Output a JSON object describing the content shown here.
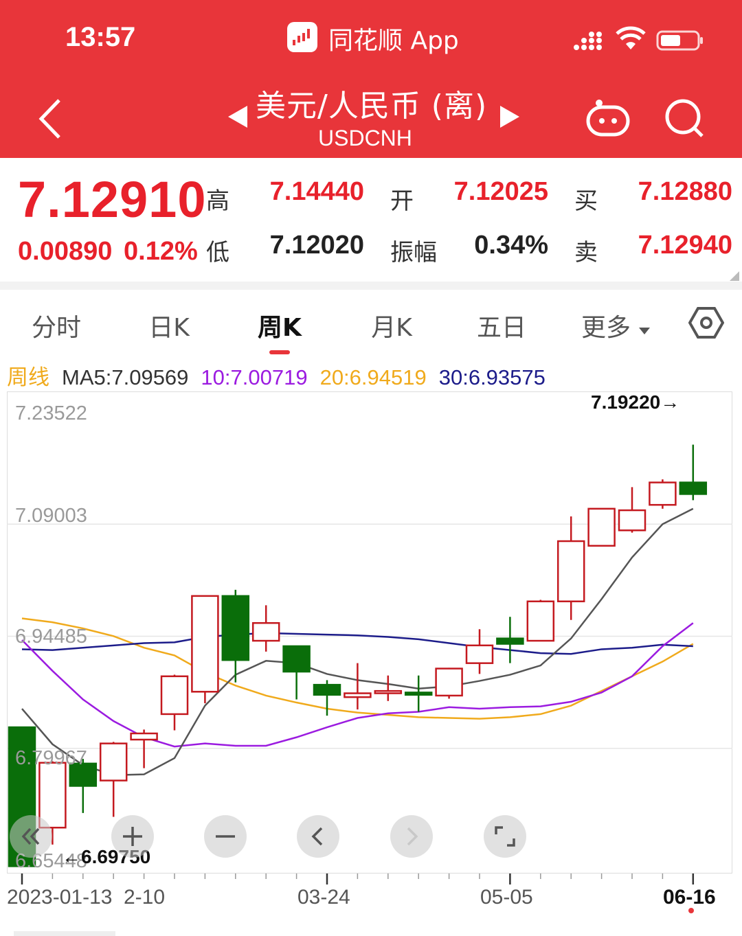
{
  "status_bar": {
    "time": "13:57",
    "app_name": "同花顺 App"
  },
  "header": {
    "title": "美元/人民币 (离)",
    "subtitle": "USDCNH"
  },
  "quote": {
    "last": "7.12910",
    "change": "0.00890",
    "change_pct": "0.12%",
    "high_label": "高",
    "high": "7.14440",
    "low_label": "低",
    "low": "7.12020",
    "open_label": "开",
    "open": "7.12025",
    "amp_label": "振幅",
    "amp": "0.34%",
    "bid_label": "买",
    "bid": "7.12880",
    "ask_label": "卖",
    "ask": "7.12940"
  },
  "tabs": [
    "分时",
    "日K",
    "周K",
    "月K",
    "五日",
    "更多"
  ],
  "active_tab": "周K",
  "ma_legend": {
    "label": "周线",
    "ma5": "MA5:7.09569",
    "ma10": "10:7.00719",
    "ma20": "20:6.94519",
    "ma30": "30:6.93575"
  },
  "colors": {
    "brand": "#e8353a",
    "up": "#c4191f",
    "down": "#0a6e0a",
    "ma5": "#555555",
    "ma10": "#9b1be0",
    "ma20": "#f0aa1c",
    "ma30": "#1c1c8a"
  },
  "chart_data": {
    "type": "candlestick",
    "y_ticks": [
      "7.23522",
      "7.09003",
      "6.94485",
      "6.79967",
      "6.65448"
    ],
    "ylim": [
      6.65448,
      7.23522
    ],
    "x_ticks": [
      "2023-01-13",
      "2-10",
      "03-24",
      "05-05",
      "06-16"
    ],
    "annotations": {
      "max": "7.19220→",
      "min": "←6.69750"
    },
    "candles": [
      {
        "o": 6.827,
        "h": 6.827,
        "c": 6.647,
        "l": 6.647
      },
      {
        "o": 6.697,
        "h": 6.783,
        "c": 6.781,
        "l": 6.675
      },
      {
        "o": 6.78,
        "h": 6.786,
        "c": 6.751,
        "l": 6.716
      },
      {
        "o": 6.758,
        "h": 6.808,
        "c": 6.806,
        "l": 6.711
      },
      {
        "o": 6.811,
        "h": 6.824,
        "c": 6.819,
        "l": 6.774
      },
      {
        "o": 6.844,
        "h": 6.895,
        "c": 6.893,
        "l": 6.823
      },
      {
        "o": 6.873,
        "h": 6.996,
        "c": 6.997,
        "l": 6.858
      },
      {
        "o": 6.997,
        "h": 7.005,
        "c": 6.914,
        "l": 6.885
      },
      {
        "o": 6.939,
        "h": 6.985,
        "c": 6.962,
        "l": 6.925
      },
      {
        "o": 6.932,
        "h": 6.929,
        "c": 6.899,
        "l": 6.863
      },
      {
        "o": 6.882,
        "h": 6.888,
        "c": 6.869,
        "l": 6.842
      },
      {
        "o": 6.866,
        "h": 6.91,
        "c": 6.871,
        "l": 6.85
      },
      {
        "o": 6.871,
        "h": 6.894,
        "c": 6.874,
        "l": 6.861
      },
      {
        "o": 6.872,
        "h": 6.894,
        "c": 6.869,
        "l": 6.847
      },
      {
        "o": 6.868,
        "h": 6.904,
        "c": 6.903,
        "l": 6.864
      },
      {
        "o": 6.91,
        "h": 6.954,
        "c": 6.933,
        "l": 6.896
      },
      {
        "o": 6.942,
        "h": 6.97,
        "c": 6.935,
        "l": 6.91
      },
      {
        "o": 6.939,
        "h": 6.992,
        "c": 6.99,
        "l": 6.94
      },
      {
        "o": 6.99,
        "h": 7.1,
        "c": 7.068,
        "l": 6.966
      },
      {
        "o": 7.062,
        "h": 7.092,
        "c": 7.11,
        "l": 7.062
      },
      {
        "o": 7.082,
        "h": 7.138,
        "c": 7.108,
        "l": 7.079
      },
      {
        "o": 7.115,
        "h": 7.148,
        "c": 7.144,
        "l": 7.11
      },
      {
        "o": 7.144,
        "h": 7.193,
        "c": 7.129,
        "l": 7.121
      }
    ],
    "ma5": [
      6.851,
      6.805,
      6.778,
      6.765,
      6.766,
      6.787,
      6.855,
      6.895,
      6.913,
      6.91,
      6.896,
      6.888,
      6.883,
      6.877,
      6.88,
      6.887,
      6.895,
      6.907,
      6.942,
      6.993,
      7.047,
      7.09,
      7.11
    ],
    "ma10": [
      6.94,
      6.9,
      6.863,
      6.835,
      6.814,
      6.802,
      6.806,
      6.803,
      6.803,
      6.814,
      6.827,
      6.839,
      6.845,
      6.847,
      6.853,
      6.851,
      6.853,
      6.854,
      6.86,
      6.872,
      6.893,
      6.932,
      6.962
    ],
    "ma20": [
      6.968,
      6.963,
      6.955,
      6.945,
      6.93,
      6.92,
      6.898,
      6.881,
      6.868,
      6.859,
      6.851,
      6.846,
      6.843,
      6.84,
      6.839,
      6.838,
      6.84,
      6.844,
      6.855,
      6.874,
      6.893,
      6.912,
      6.935
    ],
    "ma30": [
      6.928,
      6.927,
      6.93,
      6.933,
      6.936,
      6.937,
      6.944,
      6.947,
      6.949,
      6.948,
      6.947,
      6.946,
      6.944,
      6.941,
      6.936,
      6.931,
      6.927,
      6.923,
      6.922,
      6.928,
      6.93,
      6.934,
      6.932
    ]
  }
}
